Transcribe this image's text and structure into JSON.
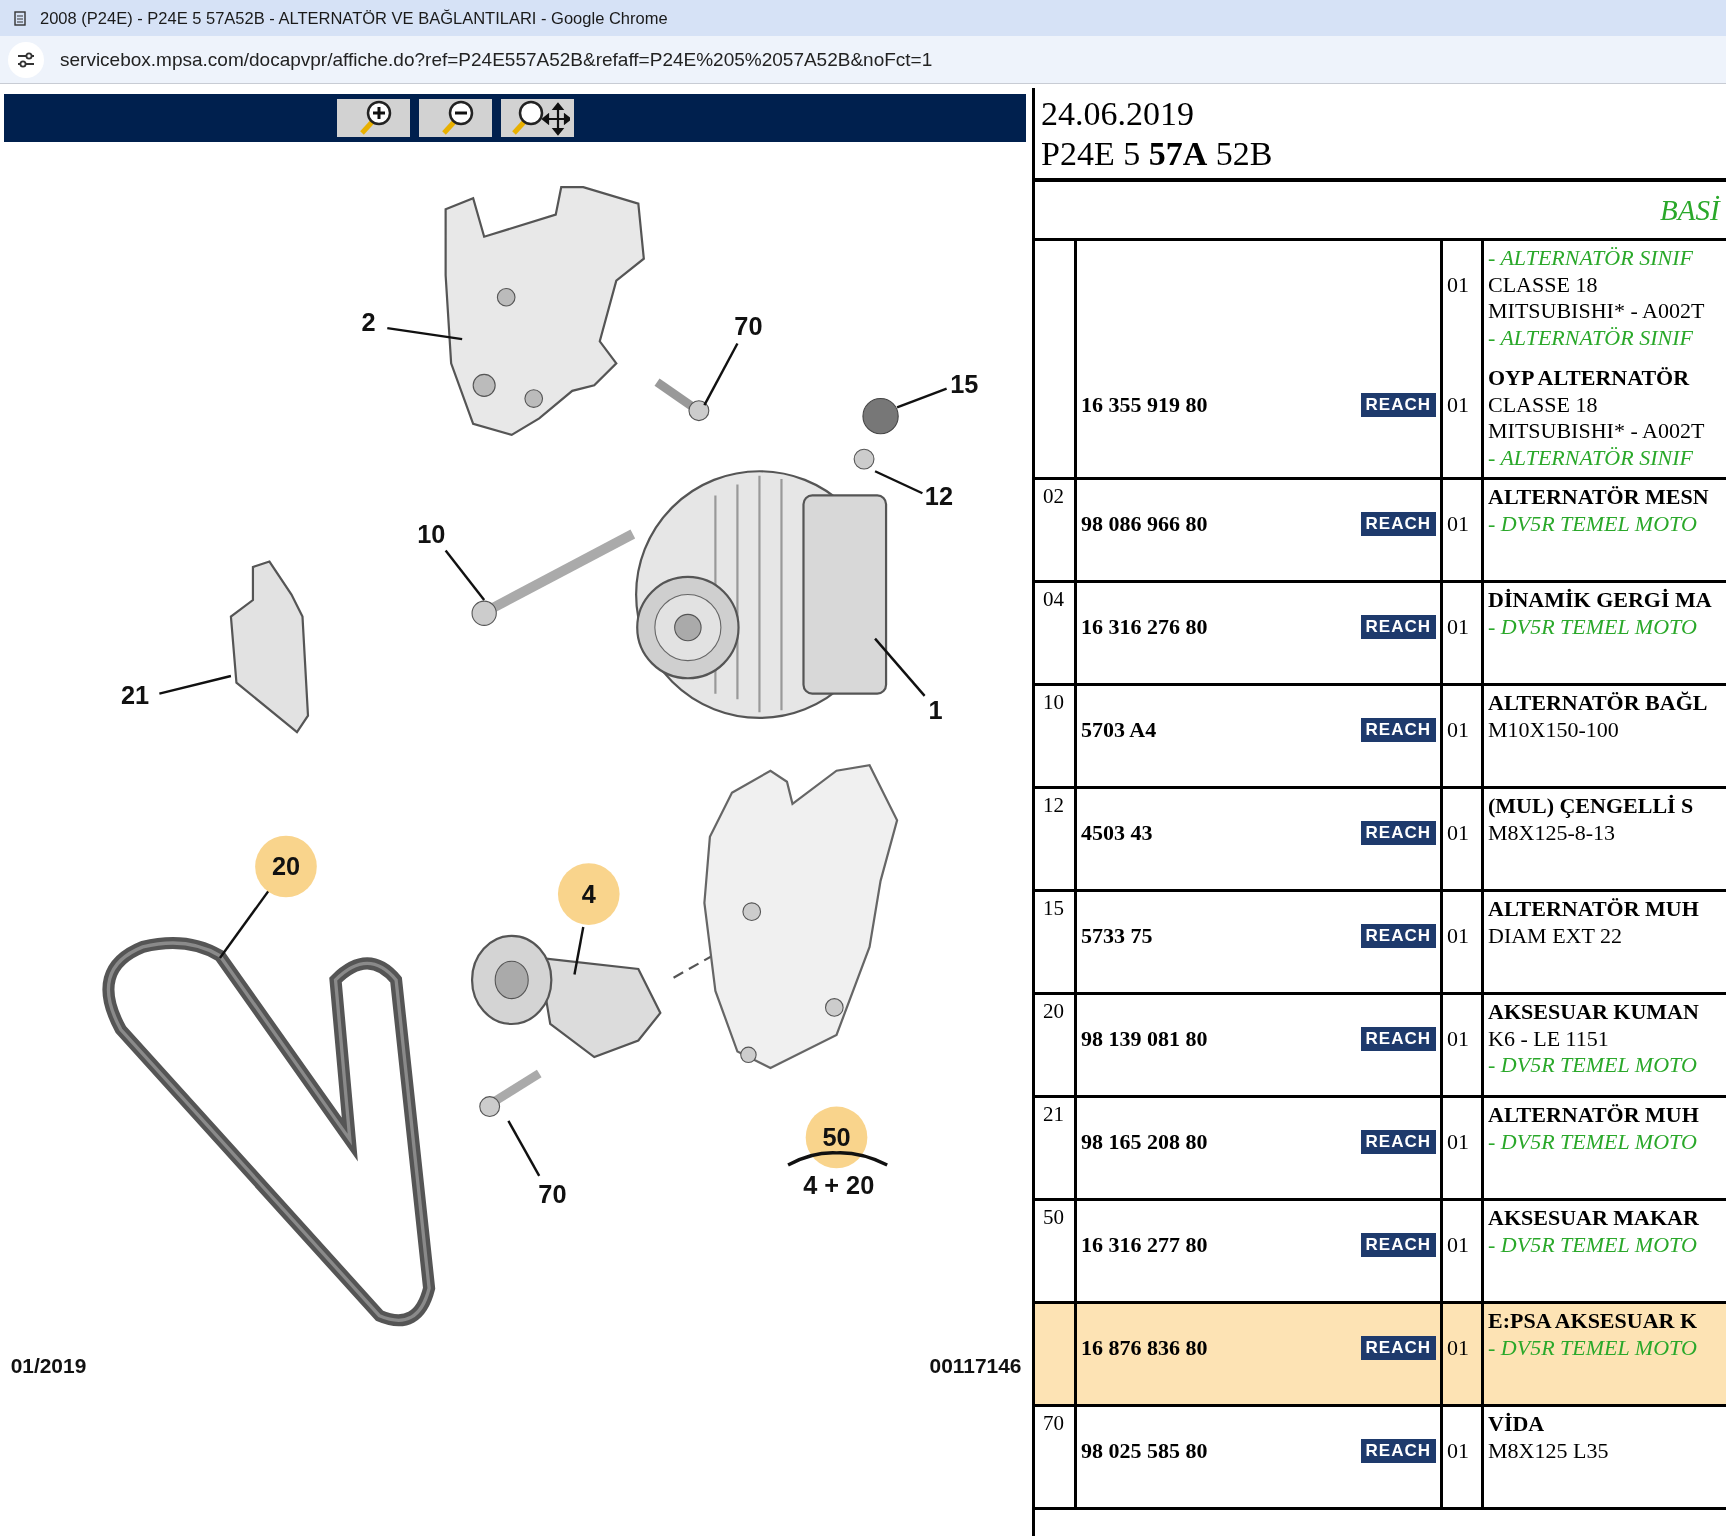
{
  "window": {
    "title": "2008 (P24E) - P24E 5 57A52B - ALTERNATÖR VE BAĞLANTILARI - Google Chrome"
  },
  "address_bar": {
    "url": "servicebox.mpsa.com/docapvpr/affiche.do?ref=P24E557A52B&refaff=P24E%205%2057A52B&noFct=1"
  },
  "diagram": {
    "callouts": [
      {
        "text": "2",
        "highlighted": false
      },
      {
        "text": "70",
        "highlighted": false
      },
      {
        "text": "15",
        "highlighted": false
      },
      {
        "text": "12",
        "highlighted": false
      },
      {
        "text": "10",
        "highlighted": false
      },
      {
        "text": "1",
        "highlighted": false
      },
      {
        "text": "21",
        "highlighted": false
      },
      {
        "text": "20",
        "highlighted": true
      },
      {
        "text": "4",
        "highlighted": true
      },
      {
        "text": "70",
        "highlighted": false
      },
      {
        "text": "50",
        "highlighted": true
      }
    ],
    "kit_note": "4 + 20",
    "date": "01/2019",
    "drawing_number": "00117146"
  },
  "header": {
    "date": "24.06.2019",
    "reference": "P24E 5 **57A** 52B",
    "section": "BASİ"
  },
  "rows": [
    {
      "selected": false,
      "blocks": [
        {
          "lines": [
            {
              "kind": "note",
              "text": "- ALTERNATÖR SINIF"
            },
            {
              "kind": "spec",
              "text": "CLASSE 18",
              "qty": "01"
            },
            {
              "kind": "spec",
              "text": "MITSUBISHI* - A002T"
            },
            {
              "kind": "note",
              "text": "- ALTERNATÖR SINIF"
            }
          ]
        },
        {
          "lines": [
            {
              "kind": "title",
              "text": "OYP ALTERNATÖR"
            },
            {
              "kind": "spec",
              "text": "CLASSE 18",
              "qty": "01",
              "part": "16 355 919 80",
              "reach": "REACH"
            },
            {
              "kind": "spec",
              "text": "MITSUBISHI* - A002T"
            },
            {
              "kind": "note",
              "text": "- ALTERNATÖR SINIF"
            }
          ]
        }
      ]
    },
    {
      "index": "02",
      "selected": false,
      "blocks": [
        {
          "lines": [
            {
              "kind": "title",
              "text": "ALTERNATÖR MESN"
            },
            {
              "kind": "note",
              "text": "- DV5R TEMEL MOTO",
              "qty": "01",
              "part": "98 086 966 80",
              "reach": "REACH"
            }
          ]
        }
      ]
    },
    {
      "index": "04",
      "selected": false,
      "blocks": [
        {
          "lines": [
            {
              "kind": "title",
              "text": "DİNAMİK GERGİ MA"
            },
            {
              "kind": "note",
              "text": "- DV5R TEMEL MOTO",
              "qty": "01",
              "part": "16 316 276 80",
              "reach": "REACH"
            }
          ]
        }
      ]
    },
    {
      "index": "10",
      "selected": false,
      "blocks": [
        {
          "lines": [
            {
              "kind": "title",
              "text": "ALTERNATÖR BAĞL"
            },
            {
              "kind": "spec",
              "text": "M10X150-100",
              "qty": "01",
              "part": "5703 A4",
              "reach": "REACH"
            }
          ]
        }
      ]
    },
    {
      "index": "12",
      "selected": false,
      "blocks": [
        {
          "lines": [
            {
              "kind": "title",
              "text": "(MUL) ÇENGELLİ S"
            },
            {
              "kind": "spec",
              "text": "M8X125-8-13",
              "qty": "01",
              "part": "4503 43",
              "reach": "REACH"
            }
          ]
        }
      ]
    },
    {
      "index": "15",
      "selected": false,
      "blocks": [
        {
          "lines": [
            {
              "kind": "title",
              "text": "ALTERNATÖR MUH"
            },
            {
              "kind": "spec",
              "text": "DIAM EXT 22",
              "qty": "01",
              "part": "5733 75",
              "reach": "REACH"
            }
          ]
        }
      ]
    },
    {
      "index": "20",
      "selected": false,
      "blocks": [
        {
          "lines": [
            {
              "kind": "title",
              "text": "AKSESUAR KUMAN"
            },
            {
              "kind": "spec",
              "text": "K6 - LE 1151",
              "qty": "01",
              "part": "98 139 081 80",
              "reach": "REACH"
            },
            {
              "kind": "note",
              "text": "- DV5R TEMEL MOTO"
            }
          ]
        }
      ]
    },
    {
      "index": "21",
      "selected": false,
      "blocks": [
        {
          "lines": [
            {
              "kind": "title",
              "text": "ALTERNATÖR MUH"
            },
            {
              "kind": "note",
              "text": "- DV5R TEMEL MOTO",
              "qty": "01",
              "part": "98 165 208 80",
              "reach": "REACH"
            }
          ]
        }
      ]
    },
    {
      "index": "50",
      "selected": false,
      "blocks": [
        {
          "lines": [
            {
              "kind": "title",
              "text": "AKSESUAR MAKAR"
            },
            {
              "kind": "note",
              "text": "- DV5R TEMEL MOTO",
              "qty": "01",
              "part": "16 316 277 80",
              "reach": "REACH"
            }
          ]
        }
      ]
    },
    {
      "selected": true,
      "blocks": [
        {
          "lines": [
            {
              "kind": "title",
              "text": "E:PSA AKSESUAR K"
            },
            {
              "kind": "note",
              "text": "- DV5R TEMEL MOTO",
              "qty": "01",
              "part": "16 876 836 80",
              "reach": "REACH"
            }
          ]
        }
      ]
    },
    {
      "index": "70",
      "selected": false,
      "blocks": [
        {
          "lines": [
            {
              "kind": "title",
              "text": "VİDA"
            },
            {
              "kind": "spec",
              "text": "M8X125 L35",
              "qty": "01",
              "part": "98 025 585 80",
              "reach": "REACH"
            }
          ]
        }
      ]
    }
  ]
}
